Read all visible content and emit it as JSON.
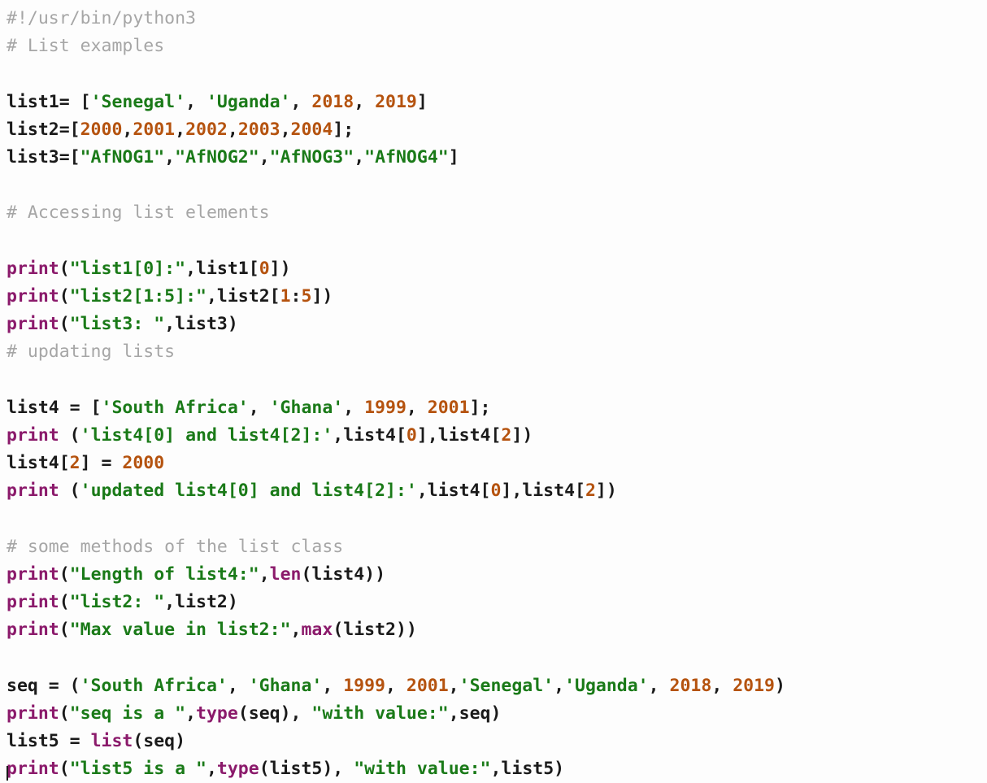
{
  "editor": {
    "language": "python",
    "background_color": "#fdfdfd",
    "colors": {
      "comment": "#a6a6a6",
      "keyword": "#8b1a6b",
      "builtin": "#8b1a6b",
      "string": "#1a7a18",
      "number": "#b5530f",
      "plain": "#1a1a1a"
    },
    "caret_visible": true
  },
  "lines": [
    {
      "n": 1,
      "tokens": [
        {
          "t": "comment",
          "v": "#!/usr/bin/python3"
        }
      ]
    },
    {
      "n": 2,
      "tokens": [
        {
          "t": "comment",
          "v": "# List examples"
        }
      ]
    },
    {
      "n": 3,
      "tokens": []
    },
    {
      "n": 4,
      "tokens": [
        {
          "t": "plain",
          "v": "list1= ["
        },
        {
          "t": "string",
          "v": "'Senegal'"
        },
        {
          "t": "plain",
          "v": ", "
        },
        {
          "t": "string",
          "v": "'Uganda'"
        },
        {
          "t": "plain",
          "v": ", "
        },
        {
          "t": "number",
          "v": "2018"
        },
        {
          "t": "plain",
          "v": ", "
        },
        {
          "t": "number",
          "v": "2019"
        },
        {
          "t": "plain",
          "v": "]"
        }
      ]
    },
    {
      "n": 5,
      "tokens": [
        {
          "t": "plain",
          "v": "list2=["
        },
        {
          "t": "number",
          "v": "2000"
        },
        {
          "t": "plain",
          "v": ","
        },
        {
          "t": "number",
          "v": "2001"
        },
        {
          "t": "plain",
          "v": ","
        },
        {
          "t": "number",
          "v": "2002"
        },
        {
          "t": "plain",
          "v": ","
        },
        {
          "t": "number",
          "v": "2003"
        },
        {
          "t": "plain",
          "v": ","
        },
        {
          "t": "number",
          "v": "2004"
        },
        {
          "t": "plain",
          "v": "];"
        }
      ]
    },
    {
      "n": 6,
      "tokens": [
        {
          "t": "plain",
          "v": "list3=["
        },
        {
          "t": "string",
          "v": "\"AfNOG1\""
        },
        {
          "t": "plain",
          "v": ","
        },
        {
          "t": "string",
          "v": "\"AfNOG2\""
        },
        {
          "t": "plain",
          "v": ","
        },
        {
          "t": "string",
          "v": "\"AfNOG3\""
        },
        {
          "t": "plain",
          "v": ","
        },
        {
          "t": "string",
          "v": "\"AfNOG4\""
        },
        {
          "t": "plain",
          "v": "]"
        }
      ]
    },
    {
      "n": 7,
      "tokens": []
    },
    {
      "n": 8,
      "tokens": [
        {
          "t": "comment",
          "v": "# Accessing list elements"
        }
      ]
    },
    {
      "n": 9,
      "tokens": []
    },
    {
      "n": 10,
      "tokens": [
        {
          "t": "builtin",
          "v": "print"
        },
        {
          "t": "plain",
          "v": "("
        },
        {
          "t": "string",
          "v": "\"list1[0]:\""
        },
        {
          "t": "plain",
          "v": ",list1["
        },
        {
          "t": "number",
          "v": "0"
        },
        {
          "t": "plain",
          "v": "])"
        }
      ]
    },
    {
      "n": 11,
      "tokens": [
        {
          "t": "builtin",
          "v": "print"
        },
        {
          "t": "plain",
          "v": "("
        },
        {
          "t": "string",
          "v": "\"list2[1:5]:\""
        },
        {
          "t": "plain",
          "v": ",list2["
        },
        {
          "t": "number",
          "v": "1"
        },
        {
          "t": "plain",
          "v": ":"
        },
        {
          "t": "number",
          "v": "5"
        },
        {
          "t": "plain",
          "v": "])"
        }
      ]
    },
    {
      "n": 12,
      "tokens": [
        {
          "t": "builtin",
          "v": "print"
        },
        {
          "t": "plain",
          "v": "("
        },
        {
          "t": "string",
          "v": "\"list3: \""
        },
        {
          "t": "plain",
          "v": ",list3)"
        }
      ]
    },
    {
      "n": 13,
      "tokens": [
        {
          "t": "comment",
          "v": "# updating lists"
        }
      ]
    },
    {
      "n": 14,
      "tokens": []
    },
    {
      "n": 15,
      "tokens": [
        {
          "t": "plain",
          "v": "list4 = ["
        },
        {
          "t": "string",
          "v": "'South Africa'"
        },
        {
          "t": "plain",
          "v": ", "
        },
        {
          "t": "string",
          "v": "'Ghana'"
        },
        {
          "t": "plain",
          "v": ", "
        },
        {
          "t": "number",
          "v": "1999"
        },
        {
          "t": "plain",
          "v": ", "
        },
        {
          "t": "number",
          "v": "2001"
        },
        {
          "t": "plain",
          "v": "];"
        }
      ]
    },
    {
      "n": 16,
      "tokens": [
        {
          "t": "builtin",
          "v": "print"
        },
        {
          "t": "plain",
          "v": " ("
        },
        {
          "t": "string",
          "v": "'list4[0] and list4[2]:'"
        },
        {
          "t": "plain",
          "v": ",list4["
        },
        {
          "t": "number",
          "v": "0"
        },
        {
          "t": "plain",
          "v": "],list4["
        },
        {
          "t": "number",
          "v": "2"
        },
        {
          "t": "plain",
          "v": "])"
        }
      ]
    },
    {
      "n": 17,
      "tokens": [
        {
          "t": "plain",
          "v": "list4["
        },
        {
          "t": "number",
          "v": "2"
        },
        {
          "t": "plain",
          "v": "] = "
        },
        {
          "t": "number",
          "v": "2000"
        }
      ]
    },
    {
      "n": 18,
      "tokens": [
        {
          "t": "builtin",
          "v": "print"
        },
        {
          "t": "plain",
          "v": " ("
        },
        {
          "t": "string",
          "v": "'updated list4[0] and list4[2]:'"
        },
        {
          "t": "plain",
          "v": ",list4["
        },
        {
          "t": "number",
          "v": "0"
        },
        {
          "t": "plain",
          "v": "],list4["
        },
        {
          "t": "number",
          "v": "2"
        },
        {
          "t": "plain",
          "v": "])"
        }
      ]
    },
    {
      "n": 19,
      "tokens": []
    },
    {
      "n": 20,
      "tokens": [
        {
          "t": "comment",
          "v": "# some methods of the list class"
        }
      ]
    },
    {
      "n": 21,
      "tokens": [
        {
          "t": "builtin",
          "v": "print"
        },
        {
          "t": "plain",
          "v": "("
        },
        {
          "t": "string",
          "v": "\"Length of list4:\""
        },
        {
          "t": "plain",
          "v": ","
        },
        {
          "t": "builtin",
          "v": "len"
        },
        {
          "t": "plain",
          "v": "(list4))"
        }
      ]
    },
    {
      "n": 22,
      "tokens": [
        {
          "t": "builtin",
          "v": "print"
        },
        {
          "t": "plain",
          "v": "("
        },
        {
          "t": "string",
          "v": "\"list2: \""
        },
        {
          "t": "plain",
          "v": ",list2)"
        }
      ]
    },
    {
      "n": 23,
      "tokens": [
        {
          "t": "builtin",
          "v": "print"
        },
        {
          "t": "plain",
          "v": "("
        },
        {
          "t": "string",
          "v": "\"Max value in list2:\""
        },
        {
          "t": "plain",
          "v": ","
        },
        {
          "t": "builtin",
          "v": "max"
        },
        {
          "t": "plain",
          "v": "(list2))"
        }
      ]
    },
    {
      "n": 24,
      "tokens": []
    },
    {
      "n": 25,
      "tokens": [
        {
          "t": "plain",
          "v": "seq = ("
        },
        {
          "t": "string",
          "v": "'South Africa'"
        },
        {
          "t": "plain",
          "v": ", "
        },
        {
          "t": "string",
          "v": "'Ghana'"
        },
        {
          "t": "plain",
          "v": ", "
        },
        {
          "t": "number",
          "v": "1999"
        },
        {
          "t": "plain",
          "v": ", "
        },
        {
          "t": "number",
          "v": "2001"
        },
        {
          "t": "plain",
          "v": ","
        },
        {
          "t": "string",
          "v": "'Senegal'"
        },
        {
          "t": "plain",
          "v": ","
        },
        {
          "t": "string",
          "v": "'Uganda'"
        },
        {
          "t": "plain",
          "v": ", "
        },
        {
          "t": "number",
          "v": "2018"
        },
        {
          "t": "plain",
          "v": ", "
        },
        {
          "t": "number",
          "v": "2019"
        },
        {
          "t": "plain",
          "v": ")"
        }
      ]
    },
    {
      "n": 26,
      "tokens": [
        {
          "t": "builtin",
          "v": "print"
        },
        {
          "t": "plain",
          "v": "("
        },
        {
          "t": "string",
          "v": "\"seq is a \""
        },
        {
          "t": "plain",
          "v": ","
        },
        {
          "t": "builtin",
          "v": "type"
        },
        {
          "t": "plain",
          "v": "(seq), "
        },
        {
          "t": "string",
          "v": "\"with value:\""
        },
        {
          "t": "plain",
          "v": ",seq)"
        }
      ]
    },
    {
      "n": 27,
      "tokens": [
        {
          "t": "plain",
          "v": "list5 = "
        },
        {
          "t": "builtin",
          "v": "list"
        },
        {
          "t": "plain",
          "v": "(seq)"
        }
      ]
    },
    {
      "n": 28,
      "tokens": [
        {
          "t": "builtin",
          "v": "print"
        },
        {
          "t": "plain",
          "v": "("
        },
        {
          "t": "string",
          "v": "\"list5 is a \""
        },
        {
          "t": "plain",
          "v": ","
        },
        {
          "t": "builtin",
          "v": "type"
        },
        {
          "t": "plain",
          "v": "(list5), "
        },
        {
          "t": "string",
          "v": "\"with value:\""
        },
        {
          "t": "plain",
          "v": ",list5)"
        }
      ]
    }
  ]
}
